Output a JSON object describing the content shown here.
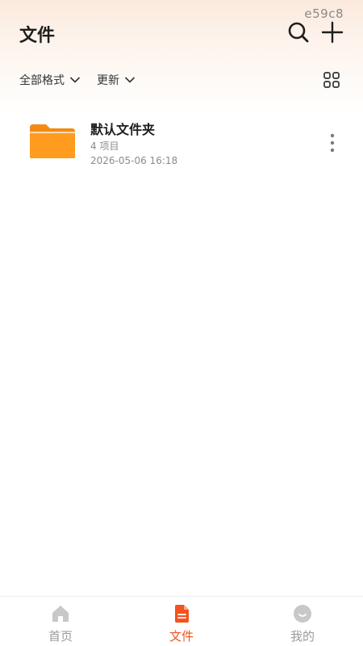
{
  "corner_id": "e59c8",
  "header": {
    "title": "文件",
    "search_icon": "search-icon",
    "add_icon": "plus-icon"
  },
  "filters": {
    "format_label": "全部格式",
    "sort_label": "更新",
    "view_icon": "grid-view-icon"
  },
  "files": [
    {
      "name": "默认文件夹",
      "count": "4 项目",
      "date": "2026-05-06 16:18",
      "icon": "folder-icon"
    }
  ],
  "bottom_nav": {
    "items": [
      {
        "label": "首页",
        "icon": "home-icon",
        "active": false
      },
      {
        "label": "文件",
        "icon": "document-icon",
        "active": true
      },
      {
        "label": "我的",
        "icon": "profile-icon",
        "active": false
      }
    ]
  },
  "colors": {
    "accent": "#f2531f",
    "folder": "#ff9c1f",
    "inactive": "#9a9a9a"
  }
}
